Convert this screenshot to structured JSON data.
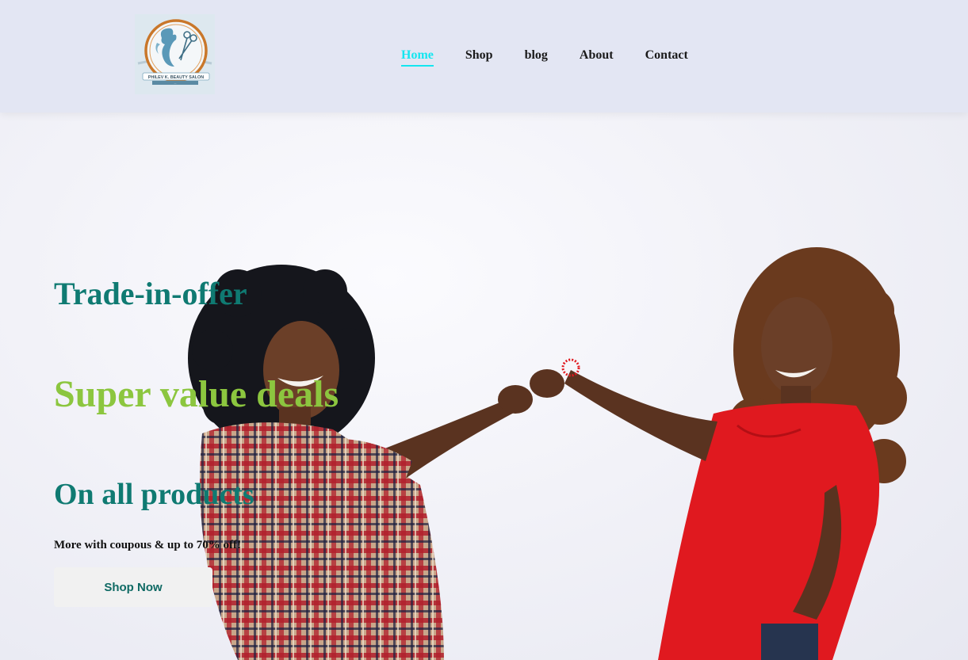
{
  "logo": {
    "alt": "Philev K. Beauty Salon logo",
    "brand_text": "PHILEV K. BEAUTY SALON",
    "tagline": "..."
  },
  "nav": {
    "items": [
      {
        "label": "Home",
        "active": true
      },
      {
        "label": "Shop",
        "active": false
      },
      {
        "label": "blog",
        "active": false
      },
      {
        "label": "About",
        "active": false
      },
      {
        "label": "Contact",
        "active": false
      }
    ]
  },
  "hero": {
    "line1": "Trade-in-offer",
    "line2": "Super value deals",
    "line3": "On all products",
    "subtext": "More with coupous & up to 70% off!",
    "button_label": "Shop Now"
  },
  "colors": {
    "active_nav": "#14e6f0",
    "heading_teal": "#0f7a72",
    "heading_green": "#8cc63f"
  }
}
